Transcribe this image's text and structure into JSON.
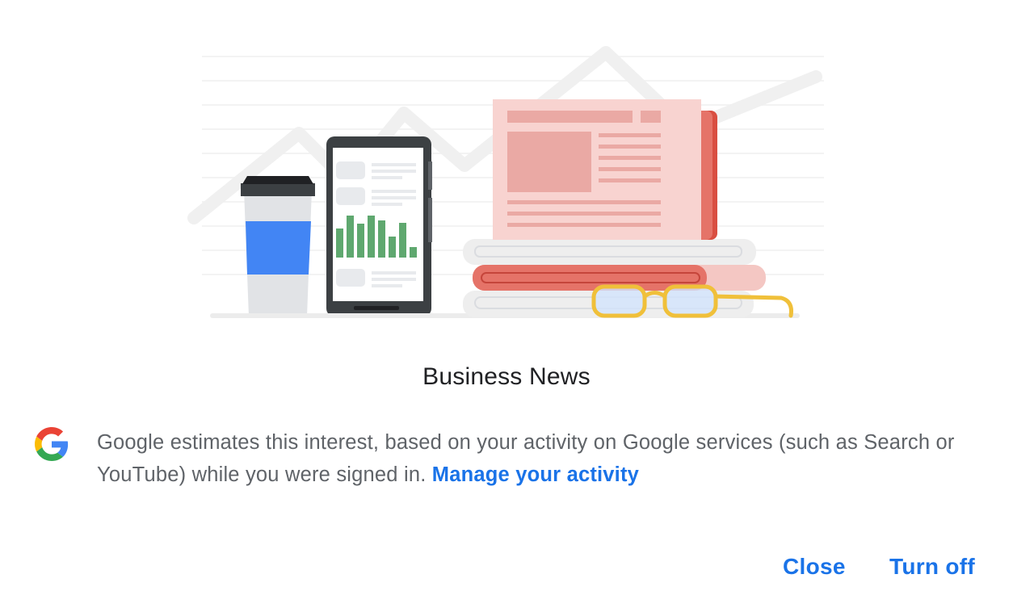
{
  "dialog": {
    "title": "Business News",
    "description": "Google estimates this interest, based on your activity on Google services (such as Search or YouTube) while you were signed in.",
    "manage_link": "Manage your activity",
    "close_label": "Close",
    "turn_off_label": "Turn off"
  },
  "icons": {
    "logo": "google-g-icon",
    "illustration": "business-news-illustration"
  },
  "colors": {
    "accent": "#1a73e8",
    "title": "#202124",
    "body_text": "#5f6368"
  }
}
